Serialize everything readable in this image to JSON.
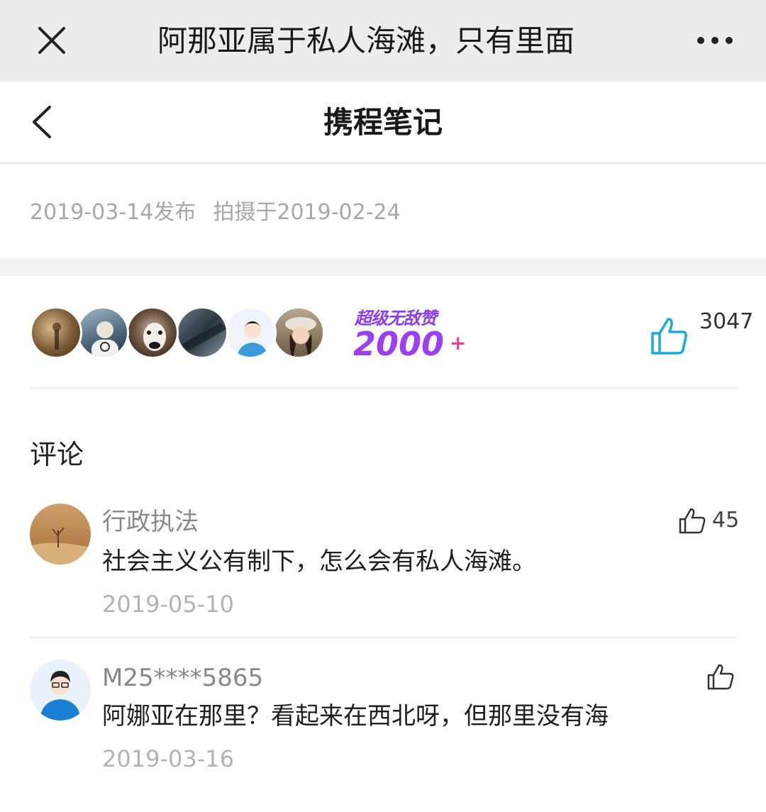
{
  "window": {
    "title": "阿那亚属于私人海滩，只有里面",
    "close_icon": "close-icon",
    "more_icon": "more-dots-icon"
  },
  "nav": {
    "title": "携程笔记",
    "back_icon": "chevron-left-icon"
  },
  "post_meta": {
    "published": "2019-03-14发布",
    "taken": "拍摄于2019-02-24"
  },
  "likes": {
    "badge_top": "超级无敌赞",
    "badge_number": "2000",
    "badge_plus": "+",
    "count": "3047",
    "icon": "thumbs-up-icon",
    "accent_color": "#1aa9d8"
  },
  "comments_section": {
    "title": "评论",
    "items": [
      {
        "name": "行政执法",
        "text": "社会主义公有制下，怎么会有私人海滩。",
        "date": "2019-05-10",
        "likes": "45"
      },
      {
        "name": "M25****5865",
        "text": "阿娜亚在那里？看起来在西北呀，但那里没有海",
        "date": "2019-03-16",
        "likes": ""
      }
    ]
  }
}
